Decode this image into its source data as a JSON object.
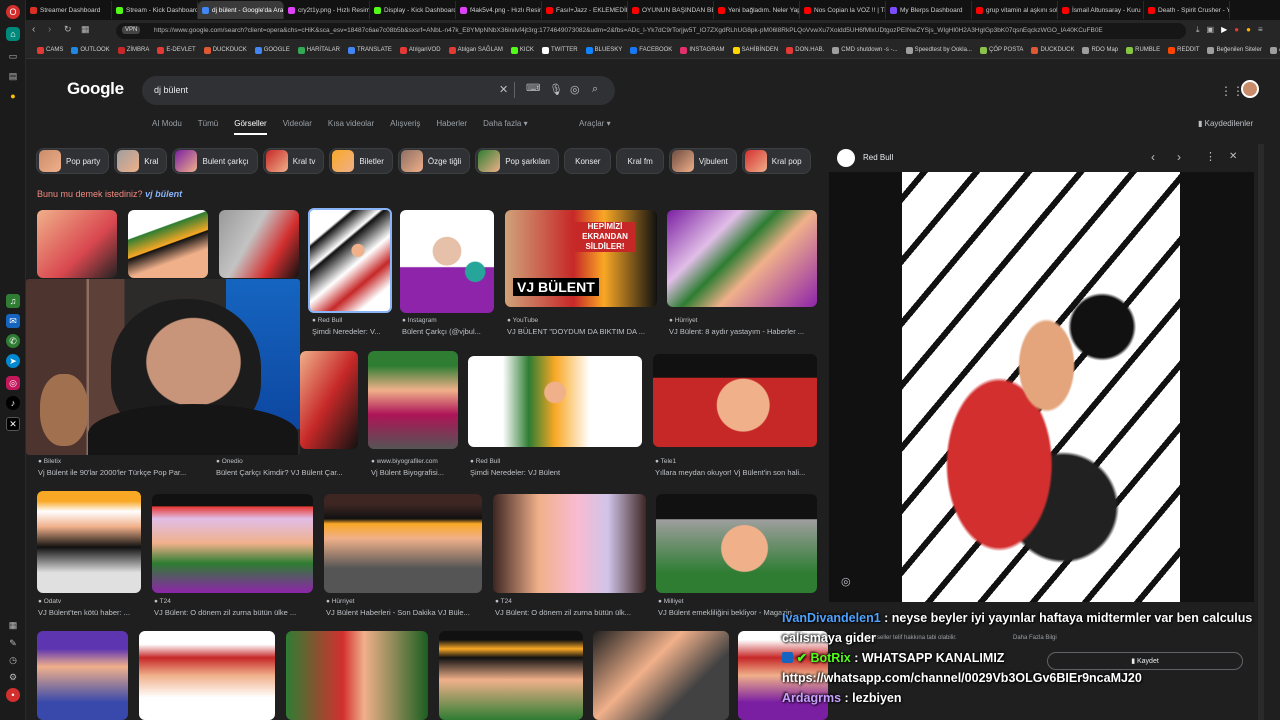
{
  "browser": {
    "tabs": [
      {
        "label": "Streamer Dashboard",
        "color": "#d93025"
      },
      {
        "label": "Stream - Kick Dashboard",
        "color": "#53fc18"
      },
      {
        "label": "dj bülent - Google'da Ara",
        "color": "#4285f4",
        "active": true
      },
      {
        "label": "cry2t1y.png - Hızlı Resim",
        "color": "#e040fb"
      },
      {
        "label": "Display - Kick Dashboard",
        "color": "#53fc18"
      },
      {
        "label": "f4ak5v4.png - Hızlı Resim",
        "color": "#e040fb"
      },
      {
        "label": "Fasıl+Jazz - EKLEMEDİR",
        "color": "#ff0000"
      },
      {
        "label": "OYUNUN BAŞINDAN BE",
        "color": "#ff0000"
      },
      {
        "label": "Yeni bağladım. Neler Yap",
        "color": "#ff0000"
      },
      {
        "label": "Nos Copian la VOZ !! | Tr",
        "color": "#ff0000"
      },
      {
        "label": "My Blerps Dashboard",
        "color": "#7c4dff"
      },
      {
        "label": "grup vitamin al aşkını sol",
        "color": "#ff0000"
      },
      {
        "label": "İsmail Altunsaray - Kuru",
        "color": "#ff0000"
      },
      {
        "label": "Death - Spirit Crusher - Y",
        "color": "#ff0000"
      }
    ],
    "url": "https://www.google.com/search?client=opera&chs=cHiK&sca_esv=18487c6ae7c08b5b&sxsrf=ANbL-n47k_E8YMpNNbX36inilvf4jt3rg:1774649073082&udm=2&fbs=ADc_l-Yk7dC9rTorjjw5T_lO7ZXgdRLhUG8pk-pM06l8RkPLQoVvwXu7Xoldd5UH6fMlxUDtgozPEINwZYSjs_WIgHl0H2A3HgIGp3bK07qsnEqckzWGO_IA40KCuFB0E",
    "bookmarks": [
      {
        "label": "CAMS",
        "color": "#e53935"
      },
      {
        "label": "OUTLOOK",
        "color": "#1e88e5"
      },
      {
        "label": "ZİMBRA",
        "color": "#c62828"
      },
      {
        "label": "E-DEVLET",
        "color": "#e53935"
      },
      {
        "label": "DUCKDUCK",
        "color": "#de5833"
      },
      {
        "label": "GOOGLE",
        "color": "#4285f4"
      },
      {
        "label": "HARİTALAR",
        "color": "#34a853"
      },
      {
        "label": "TRANSLATE",
        "color": "#4285f4"
      },
      {
        "label": "AtılganVOD",
        "color": "#e53935"
      },
      {
        "label": "Atılgan SAĞLAM",
        "color": "#e53935"
      },
      {
        "label": "KICK",
        "color": "#53fc18"
      },
      {
        "label": "TWITTER",
        "color": "#ffffff"
      },
      {
        "label": "BLUESKY",
        "color": "#1185fe"
      },
      {
        "label": "FACEBOOK",
        "color": "#1877f2"
      },
      {
        "label": "INSTAGRAM",
        "color": "#e1306c"
      },
      {
        "label": "SAHİBİNDEN",
        "color": "#ffd600"
      },
      {
        "label": "DON.HAB.",
        "color": "#e53935"
      },
      {
        "label": "CMD shutdown -s -...",
        "color": "#9e9e9e"
      },
      {
        "label": "Speedtest by Ookla...",
        "color": "#9e9e9e"
      },
      {
        "label": "ÇÖP POSTA",
        "color": "#8bc34a"
      },
      {
        "label": "DUCKDUCK",
        "color": "#de5833"
      },
      {
        "label": "RDO Map",
        "color": "#9e9e9e"
      },
      {
        "label": "RUMBLE",
        "color": "#85c742"
      },
      {
        "label": "REDDIT",
        "color": "#ff4500"
      },
      {
        "label": "Beğenilen Siteler",
        "color": "#9e9e9e"
      },
      {
        "label": "ALIŞVERİŞ",
        "color": "#9e9e9e"
      }
    ]
  },
  "google": {
    "logo": "Google",
    "query": "dj bülent",
    "nav": [
      "AI Modu",
      "Tümü",
      "Görseller",
      "Videolar",
      "Kısa videolar",
      "Alışveriş",
      "Haberler",
      "Daha fazla ▾"
    ],
    "active_nav": "Görseller",
    "tools": "Araçlar ▾",
    "saved": "Kaydedilenler",
    "chips": [
      {
        "label": "Pop party",
        "img": true
      },
      {
        "label": "Kral",
        "img": true
      },
      {
        "label": "Bulent çarkçı",
        "img": true
      },
      {
        "label": "Kral tv",
        "img": true
      },
      {
        "label": "Biletler",
        "img": true
      },
      {
        "label": "Özge tiğli",
        "img": true
      },
      {
        "label": "Pop şarkıları",
        "img": true
      },
      {
        "label": "Konser",
        "img": false
      },
      {
        "label": "Kral fm",
        "img": false
      },
      {
        "label": "Vjbulent",
        "img": true
      },
      {
        "label": "Kral pop",
        "img": true
      }
    ],
    "did_you_mean": "Bunu mu demek istediniz?",
    "did_you_mean_suggestion": "vj bülent",
    "results": [
      {
        "source": "Red Bull",
        "caption": "Şimdi Neredeler: V..."
      },
      {
        "source": "Instagram",
        "caption": "Bülent Çarkçı (@vjbul..."
      },
      {
        "source": "YouTube",
        "caption": "VJ BÜLENT \"DOYDUM DA BIKTIM DA ..."
      },
      {
        "source": "Hürriyet",
        "caption": "VJ Bülent: 8 aydır yastayım - Haberler ..."
      },
      {
        "source": "Biletix",
        "caption": "Vj Bülent ile 90'lar 2000'ler Türkçe Pop Par..."
      },
      {
        "source": "Onedio",
        "caption": "Bülent Çarkçı Kimdir? VJ Bülent Çar..."
      },
      {
        "source": "www.biyografiler.com",
        "caption": "Vj Bülent Biyografisi..."
      },
      {
        "source": "Red Bull",
        "caption": "Şimdi Neredeler: VJ Bülent"
      },
      {
        "source": "Tele1",
        "caption": "Yıllara meydan okuyor! Vj Bülent'in son hali..."
      },
      {
        "source": "Odatv",
        "caption": "VJ Bülent'ten kötü haber: ..."
      },
      {
        "source": "T24",
        "caption": "VJ Bülent: O dönem zil zurna bütün ülke ..."
      },
      {
        "source": "Hürriyet",
        "caption": "VJ Bülent Haberleri - Son Dakika VJ Büle..."
      },
      {
        "source": "T24",
        "caption": "VJ Bülent: O dönem zil zurna bütün ülk..."
      },
      {
        "source": "Milliyet",
        "caption": "VJ Bülent emekliliğini bekliyor - Magazin ..."
      }
    ],
    "yt_banner_1": "HEPİMİZİ EKRANDAN SİLDİLER!",
    "yt_banner_2": "VJ BÜLENT",
    "panel": {
      "source": "Red Bull",
      "behind_text_1": "Görseller telif hakkına tabi olabilir.",
      "behind_text_2": "Daha Fazla Bilgi",
      "save": "Kaydet"
    }
  },
  "chat": [
    {
      "user": "IvanDivandelen1",
      "user_color": "#4fa3ff",
      "message": "neyse beyler iyi yayınlar haftaya midtermler var ben calculus calismaya gider"
    },
    {
      "user": "BotRix",
      "user_color": "#53fc18",
      "message": "WHATSAPP KANALIMIZ"
    },
    {
      "user": "",
      "user_color": "#ffffff",
      "message": "https://whatsapp.com/channel/0029Vb3OLGv6BIEr9ncaMJ20"
    },
    {
      "user": "Ardagrms",
      "user_color": "#c7a0ff",
      "message": "lezbiyen"
    }
  ]
}
